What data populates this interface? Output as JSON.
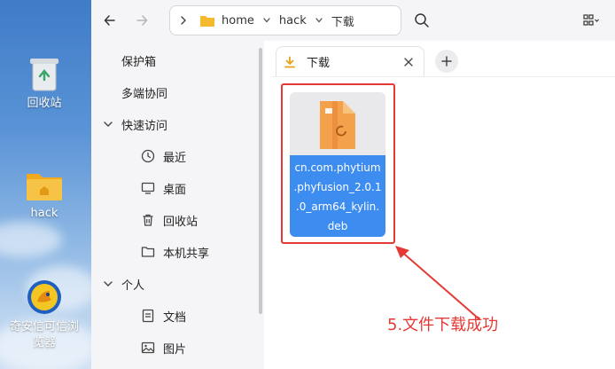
{
  "desktop": {
    "icons": [
      {
        "label": "回收站",
        "icon": "recycle-bin-icon"
      },
      {
        "label": "hack",
        "icon": "folder-icon"
      },
      {
        "label": "奇安信可信浏览器",
        "label_line1": "奇安信可信浏",
        "label_line2": "览器",
        "icon": "browser-icon"
      }
    ]
  },
  "toolbar": {
    "back_icon": "back-arrow-icon",
    "forward_icon": "forward-arrow-icon",
    "breadcrumb": {
      "expand_icon": "chevron-right-icon",
      "items": [
        "home",
        "hack",
        "下载"
      ]
    },
    "search_icon": "search-icon",
    "view_icon": "grid-view-icon"
  },
  "sidebar": {
    "items": [
      {
        "label": "保护箱"
      },
      {
        "label": "多端协同"
      },
      {
        "label": "快速访问",
        "expanded": true
      },
      {
        "label": "最近",
        "icon": "clock-icon"
      },
      {
        "label": "桌面",
        "icon": "monitor-icon"
      },
      {
        "label": "回收站",
        "icon": "trash-icon"
      },
      {
        "label": "本机共享",
        "icon": "folder-outline-icon"
      },
      {
        "label": "个人",
        "expanded": true
      },
      {
        "label": "文档",
        "icon": "document-icon"
      },
      {
        "label": "图片",
        "icon": "image-icon"
      }
    ]
  },
  "tabs": [
    {
      "label": "下载",
      "icon": "download-icon",
      "close_icon": "close-icon"
    }
  ],
  "add_tab_icon": "plus-icon",
  "files": [
    {
      "name": "cn.com.phytium.phyfusion_2.0.1.0_arm64_kylin.deb",
      "line1": "cn.com.phytium",
      "line2": ".phyfusion_2.0.1",
      "line3": ".0_arm64_kylin.",
      "line4": "deb",
      "selected": true,
      "icon": "deb-package-icon"
    }
  ],
  "annotation": "5.文件下载成功",
  "colors": {
    "selection": "#3d8cf0",
    "annotation": "#e53935",
    "folder": "#f5b92e"
  }
}
